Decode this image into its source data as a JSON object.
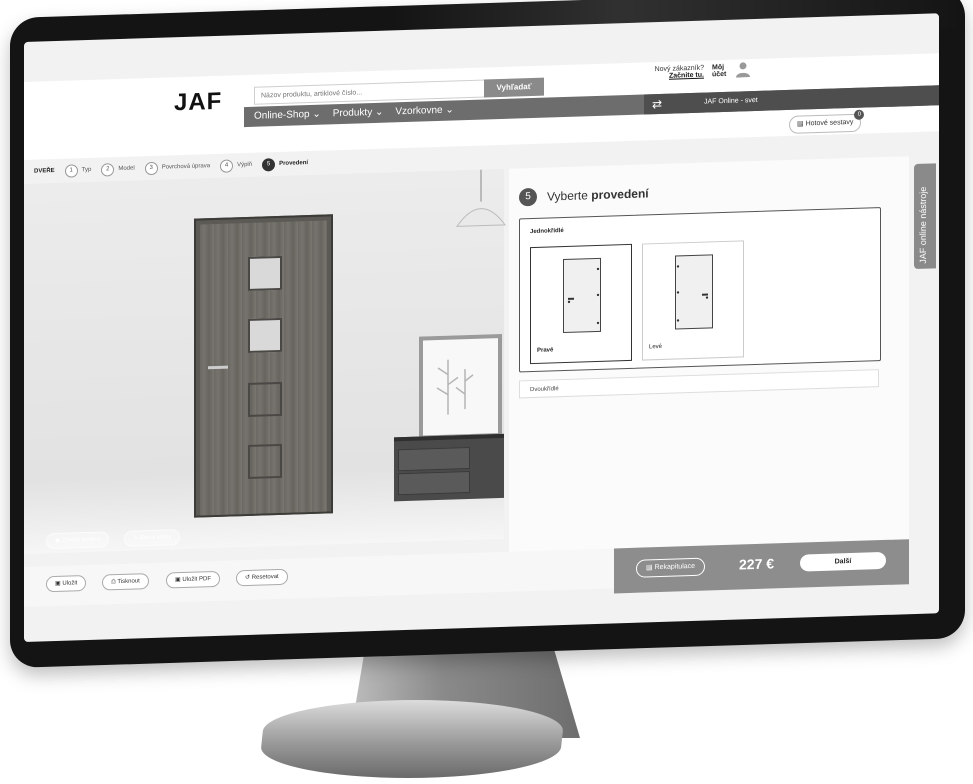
{
  "header": {
    "logo": "JAF",
    "search_placeholder": "Názov produktu, artiklové číslo...",
    "search_button": "Vyhľadať",
    "nav": [
      "Online-Shop ⌄",
      "Produkty ⌄",
      "Vzorkovne ⌄"
    ],
    "online_label": "JAF Online - svet",
    "new_customer": "Nový zákazník?",
    "start_here": "Začnite tu.",
    "account_line1": "Môj",
    "account_line2": "účet",
    "ready_sets": "Hotové sestavy",
    "ready_sets_badge": "0"
  },
  "steps": {
    "title": "DVEŘE",
    "items": [
      {
        "num": "1",
        "label": "Typ"
      },
      {
        "num": "2",
        "label": "Model"
      },
      {
        "num": "3",
        "label": "Povrchová úprava"
      },
      {
        "num": "4",
        "label": "Výplň"
      },
      {
        "num": "5",
        "label": "Provedení"
      }
    ]
  },
  "preview": {
    "buttons": [
      "Změnit pohled",
      "Barva stěny"
    ]
  },
  "panel": {
    "step_number": "5",
    "heading_plain": "Vyberte",
    "heading_bold": "provedení",
    "group_single": "Jednokřídlé",
    "options": [
      {
        "label": "Pravé",
        "selected": true
      },
      {
        "label": "Levé",
        "selected": false
      }
    ],
    "group_double": "Dvoukřídlé"
  },
  "tools_tab": "JAF online nástroje",
  "bottom": {
    "buttons": [
      "Uložit",
      "Tisknout",
      "Uložit PDF",
      "Resetovat"
    ]
  },
  "cart": {
    "recap": "Rekapitulace",
    "price": "227 €",
    "next": "Další"
  },
  "colors": {
    "bezel": "#141414",
    "accent_gray": "#6d6d6d",
    "dark_gray": "#4e4e4e",
    "cart_bar": "#8d8d8d"
  }
}
